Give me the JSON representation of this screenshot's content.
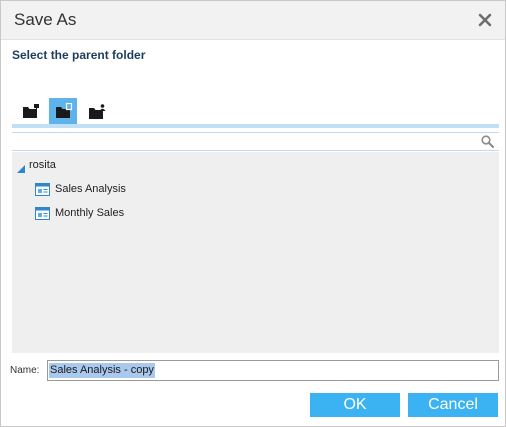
{
  "dialog": {
    "title": "Save As",
    "close_icon": "close-icon",
    "subtitle": "Select the parent folder"
  },
  "tabs": [
    {
      "icon": "folder-tree-icon",
      "active": false
    },
    {
      "icon": "folder-shared-icon",
      "active": true
    },
    {
      "icon": "folder-user-icon",
      "active": false
    }
  ],
  "search": {
    "value": "",
    "icon": "search-icon"
  },
  "tree": {
    "root": {
      "label": "rosita",
      "expanded": true,
      "icon": "expand-triangle-icon"
    },
    "children": [
      {
        "label": "Sales Analysis",
        "icon": "report-icon"
      },
      {
        "label": "Monthly Sales",
        "icon": "report-icon"
      }
    ]
  },
  "name_field": {
    "label": "Name:",
    "value": "Sales Analysis - copy"
  },
  "buttons": {
    "ok": "OK",
    "cancel": "Cancel"
  },
  "colors": {
    "accent": "#3bb3f3",
    "tab_active": "#5db3ea",
    "subtitle": "#1d3d5c",
    "tree_bg": "#efefef"
  }
}
